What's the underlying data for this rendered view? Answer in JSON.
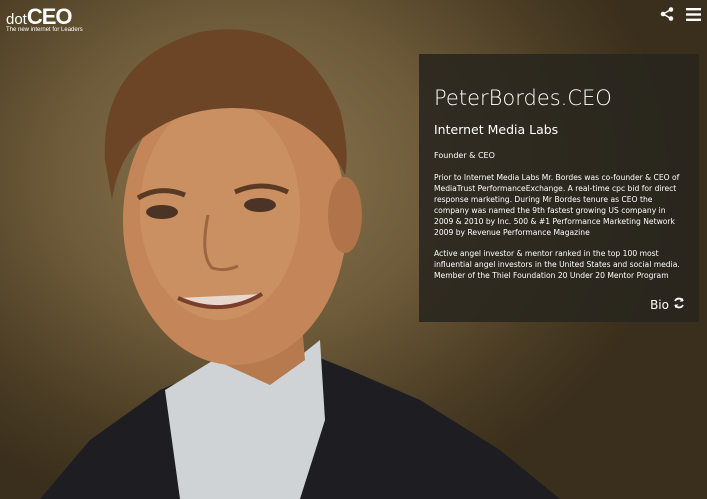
{
  "logo": {
    "dot": "dot",
    "ceo": "CEO",
    "tagline": "The new internet for Leaders"
  },
  "icons": {
    "share": "share-icon",
    "menu": "menu-icon",
    "refresh": "refresh-icon"
  },
  "profile": {
    "name": "PeterBordes.CEO",
    "company": "Internet Media Labs",
    "role": "Founder & CEO",
    "bio_paragraph_1": "Prior to Internet Media Labs Mr. Bordes was co-founder & CEO of MediaTrust PerformanceExchange. A real-time cpc bid for direct response marketing. During Mr Bordes tenure as CEO the company was named the 9th fastest growing US company in 2009 & 2010 by Inc. 500 & #1 Performance Marketing Network 2009 by Revenue Performance Magazine",
    "bio_paragraph_2": "Active angel investor & mentor ranked in the top 100 most influential angel investors in the United States and social media. Member of the Thiel Foundation 20 Under 20 Mentor Program",
    "bio_button_label": "Bio"
  },
  "colors": {
    "panel_bg": "#28261e",
    "text": "#ffffff"
  }
}
